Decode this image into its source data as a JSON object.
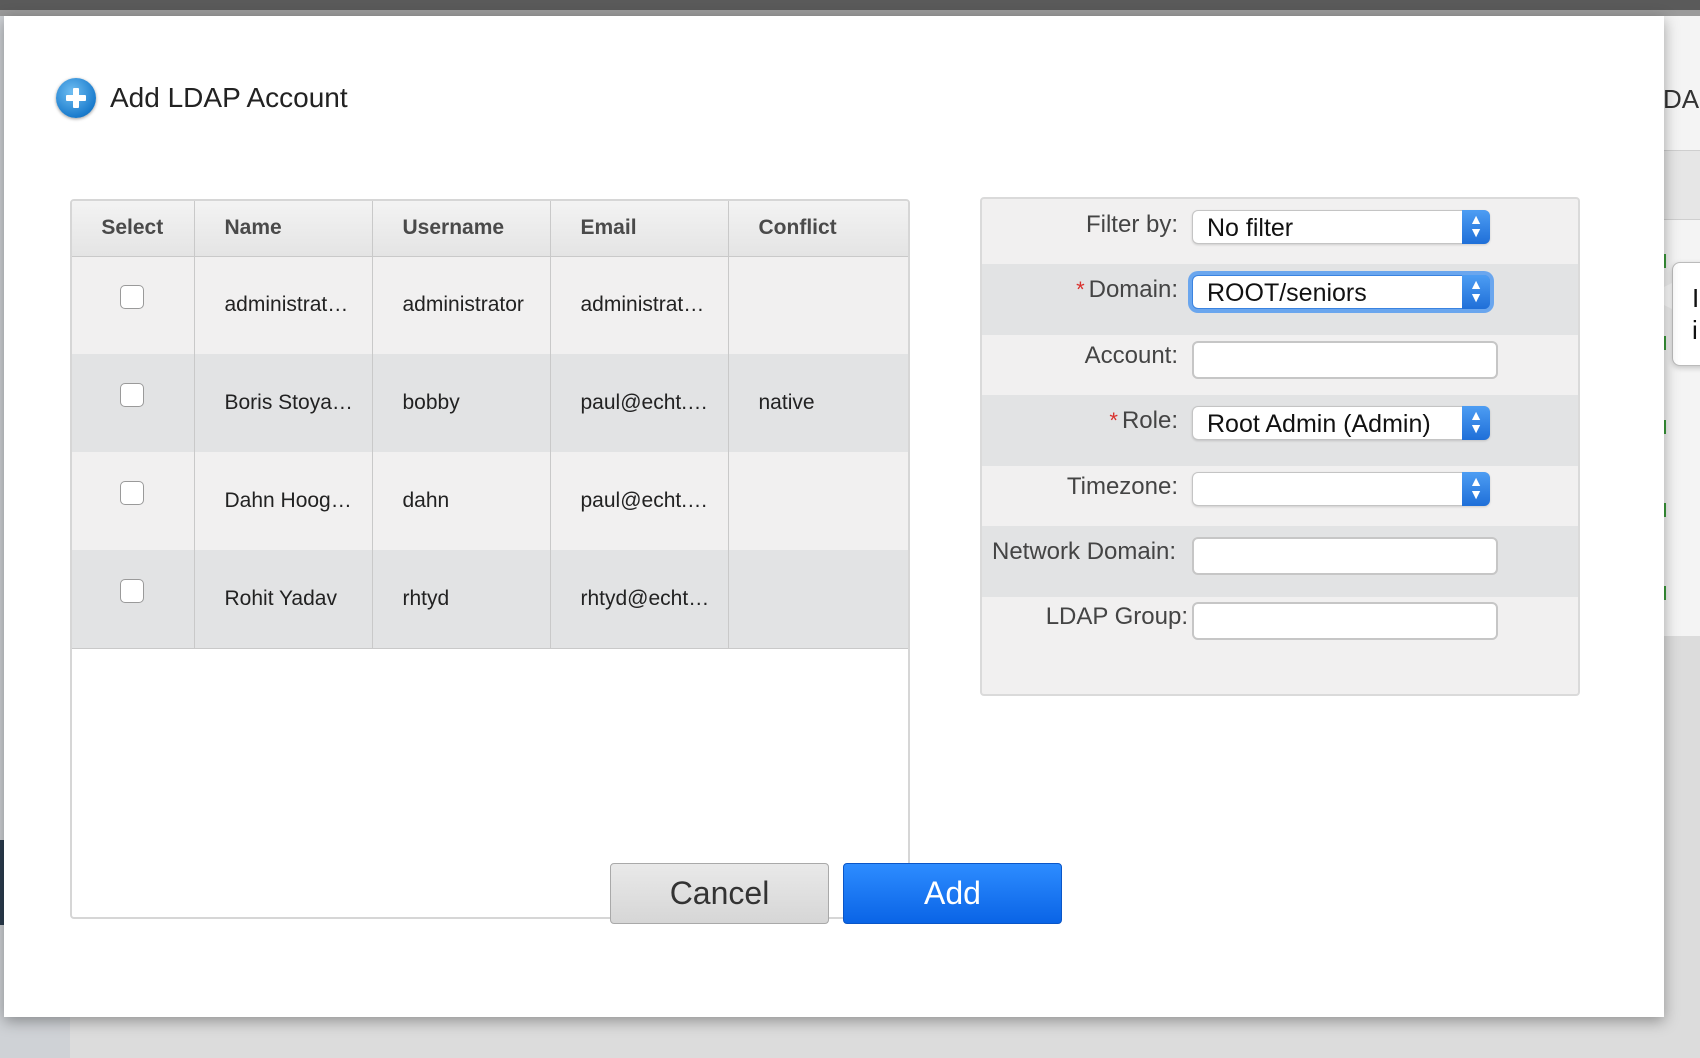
{
  "dialog": {
    "title": "Add LDAP Account",
    "icon": "add-circle-icon"
  },
  "table": {
    "columns": [
      "Select",
      "Name",
      "Username",
      "Email",
      "Conflict"
    ],
    "rows": [
      {
        "name": "administrat…",
        "username": "administrator",
        "email": "administrat…",
        "conflict": ""
      },
      {
        "name": "Boris Stoya…",
        "username": "bobby",
        "email": "paul@echt.…",
        "conflict": "native"
      },
      {
        "name": "Dahn Hoog…",
        "username": "dahn",
        "email": "paul@echt.…",
        "conflict": ""
      },
      {
        "name": "Rohit Yadav",
        "username": "rhtyd",
        "email": "rhtyd@echt…",
        "conflict": ""
      }
    ]
  },
  "form": {
    "filter_by": {
      "label": "Filter by:",
      "value": "No filter"
    },
    "domain": {
      "label": "Domain:",
      "value": "ROOT/seniors",
      "required": true
    },
    "account": {
      "label": "Account:",
      "value": ""
    },
    "role": {
      "label": "Role:",
      "value": "Root Admin (Admin)",
      "required": true
    },
    "timezone": {
      "label": "Timezone:",
      "value": ""
    },
    "network_domain": {
      "label": "Network Domain:",
      "value": ""
    },
    "ldap_group": {
      "label": "LDAP Group:",
      "value": ""
    },
    "required_marker": "*"
  },
  "buttons": {
    "cancel": "Cancel",
    "add": "Add"
  },
  "background": {
    "right_partial_text": "DAI",
    "tooltip_text": "I\ni"
  },
  "colors": {
    "primary_button": "#0a64e6",
    "required": "#d9302c",
    "focus_ring": "#6aa6ee"
  }
}
